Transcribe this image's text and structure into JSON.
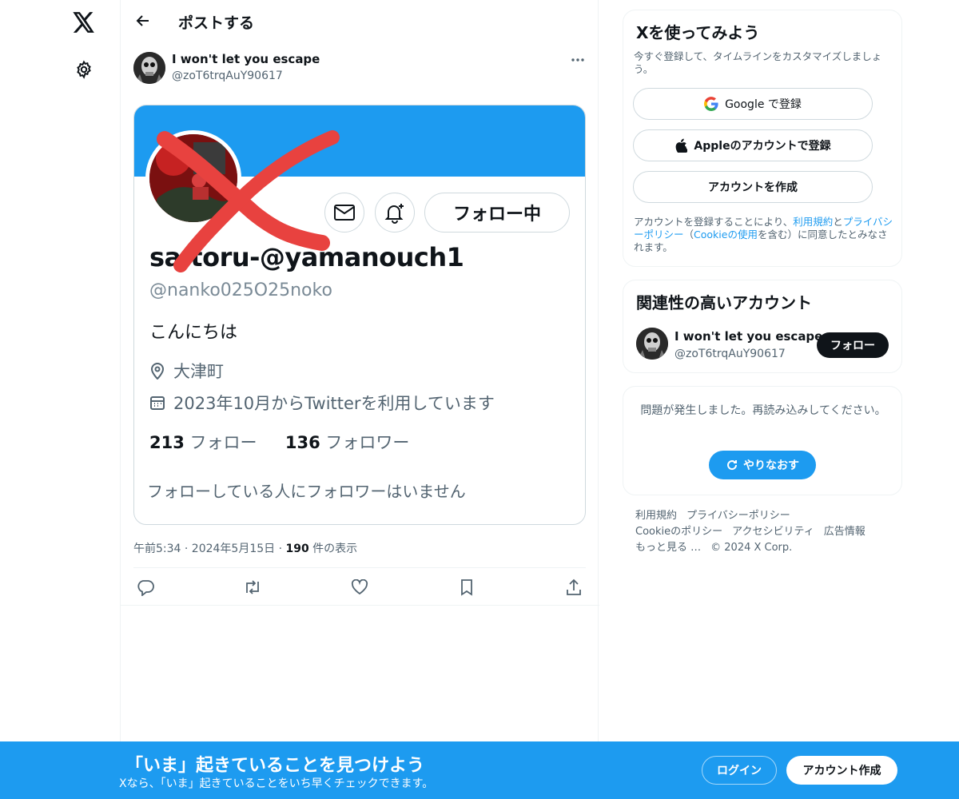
{
  "nav": {
    "logo_icon": "x-logo-icon",
    "settings_icon": "gear-icon"
  },
  "header": {
    "title": "ポストする"
  },
  "post": {
    "author_name": "I won't let you escape",
    "author_handle": "@zoT6trqAuY90617",
    "timestamp": "午前5:34 · 2024年5月15日 · ",
    "views_count": "190",
    "views_label": " 件の表示"
  },
  "embedded_profile": {
    "following_button": "フォロー中",
    "name": "sa.toru-@yamanouch1",
    "handle": "@nanko025O25noko",
    "bio": "こんにちは",
    "location": "大津町",
    "joined": "2023年10月からTwitterを利用しています",
    "following_count": "213",
    "following_label": " フォロー",
    "followers_count": "136",
    "followers_label": " フォロワー",
    "note": "フォローしている人にフォロワーはいません",
    "colors": {
      "banner": "#1d9bf0",
      "scribble": "#e8423f"
    }
  },
  "signup_card": {
    "title": "Xを使ってみよう",
    "subtitle": "今すぐ登録して、タイムラインをカスタマイズしましょう。",
    "google_bold": "Google",
    "google_rest": " で登録",
    "apple_label": "Appleのアカウントで登録",
    "create_label": "アカウントを作成",
    "legal_1": "アカウントを登録することにより、",
    "legal_terms": "利用規約",
    "legal_2": "と",
    "legal_privacy": "プライバシーポリシー",
    "legal_3": "（",
    "legal_cookie": "Cookieの使用",
    "legal_4": "を含む）に同意したとみなされます。"
  },
  "related_card": {
    "title": "関連性の高いアカウント",
    "name": "I won't let you escape",
    "handle": "@zoT6trqAuY90617",
    "follow_label": "フォロー"
  },
  "error_card": {
    "message": "問題が発生しました。再読み込みしてください。",
    "retry_label": "やりなおす"
  },
  "footer": {
    "links": [
      "利用規約",
      "プライバシーポリシー",
      "Cookieのポリシー",
      "アクセシビリティ",
      "広告情報",
      "もっと見る …",
      "© 2024 X Corp."
    ]
  },
  "bottom_bar": {
    "title": "「いま」起きていることを見つけよう",
    "subtitle": "Xなら、「いま」起きていることをいち早くチェックできます。",
    "login_label": "ログイン",
    "signup_label": "アカウント作成",
    "color": "#1d9bf0"
  }
}
